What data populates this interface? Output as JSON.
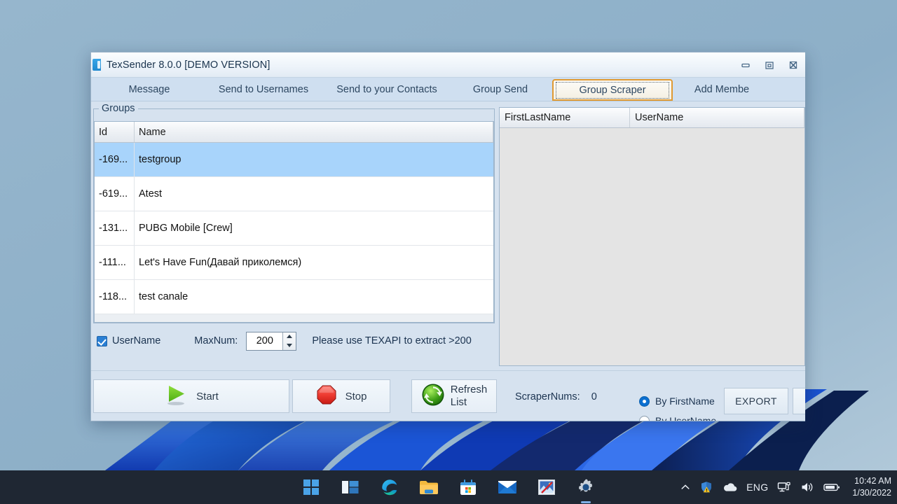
{
  "desktop": {
    "wallpaper_name": "windows-11-bloom-wallpaper",
    "background_color": "#8fb1c9"
  },
  "window": {
    "title": "TexSender 8.0.0 [DEMO VERSION]",
    "app_icon": "texsender-app-icon",
    "controls": {
      "minimize": "minimize-icon",
      "restore": "restore-icon",
      "close": "close-icon"
    }
  },
  "tabs": [
    {
      "label": "Message",
      "selected": false
    },
    {
      "label": "Send to Usernames",
      "selected": false
    },
    {
      "label": "Send to your Contacts",
      "selected": false
    },
    {
      "label": "Group Send",
      "selected": false
    },
    {
      "label": "Group Scraper",
      "selected": true
    },
    {
      "label": "Add Membe",
      "selected": false
    }
  ],
  "groups_panel": {
    "legend": "Groups",
    "columns": [
      "Id",
      "Name"
    ],
    "rows": [
      {
        "id": "-169...",
        "name": "testgroup",
        "selected": true
      },
      {
        "id": "-619...",
        "name": "Atest",
        "selected": false
      },
      {
        "id": "-131...",
        "name": "PUBG Mobile [Crew]",
        "selected": false
      },
      {
        "id": "-111...",
        "name": "Let's Have Fun(Давай приколемся)",
        "selected": false
      },
      {
        "id": "-118...",
        "name": "test canale",
        "selected": false
      }
    ]
  },
  "options": {
    "username_checkbox_label": "UserName",
    "username_checked": true,
    "maxnum_label": "MaxNum:",
    "maxnum_value": "200",
    "hint": "Please use TEXAPI to extract >200"
  },
  "result_panel": {
    "columns": [
      "FirstLastName",
      "UserName"
    ],
    "rows": []
  },
  "bottom_bar": {
    "start_label": "Start",
    "start_icon": "play-icon",
    "stop_label": "Stop",
    "stop_icon": "stop-octagon-icon",
    "refresh_label_line1": "Refresh",
    "refresh_label_line2": "List",
    "refresh_icon": "refresh-circle-icon",
    "scrapernums_label": "ScraperNums:",
    "scrapernums_value": "0",
    "radio_first_label": "By FirstName",
    "radio_user_label": "By UserName",
    "radio_selected": "By FirstName",
    "export_label": "EXPORT"
  },
  "taskbar": {
    "items": [
      {
        "icon": "windows-start-icon",
        "active": false
      },
      {
        "icon": "task-view-icon",
        "active": false
      },
      {
        "icon": "microsoft-edge-icon",
        "active": false
      },
      {
        "icon": "file-explorer-icon",
        "active": false
      },
      {
        "icon": "microsoft-store-icon",
        "active": false
      },
      {
        "icon": "mail-icon",
        "active": false
      },
      {
        "icon": "photos-icon",
        "active": false
      },
      {
        "icon": "settings-gear-icon",
        "active": true
      }
    ],
    "tray": {
      "overflow_icon": "chevron-up-icon",
      "defender_icon": "defender-shield-warning-icon",
      "onedrive_icon": "onedrive-cloud-icon",
      "language": "ENG",
      "network_icon": "network-icon",
      "volume_icon": "volume-icon",
      "battery_icon": "battery-icon"
    },
    "clock": {
      "time": "10:42 AM",
      "date": "1/30/2022"
    }
  },
  "colors": {
    "accent_orange": "#e09a32",
    "selection_blue": "#a8d4fb",
    "radio_blue": "#0b6fd0",
    "taskbar": "#1f2733"
  }
}
